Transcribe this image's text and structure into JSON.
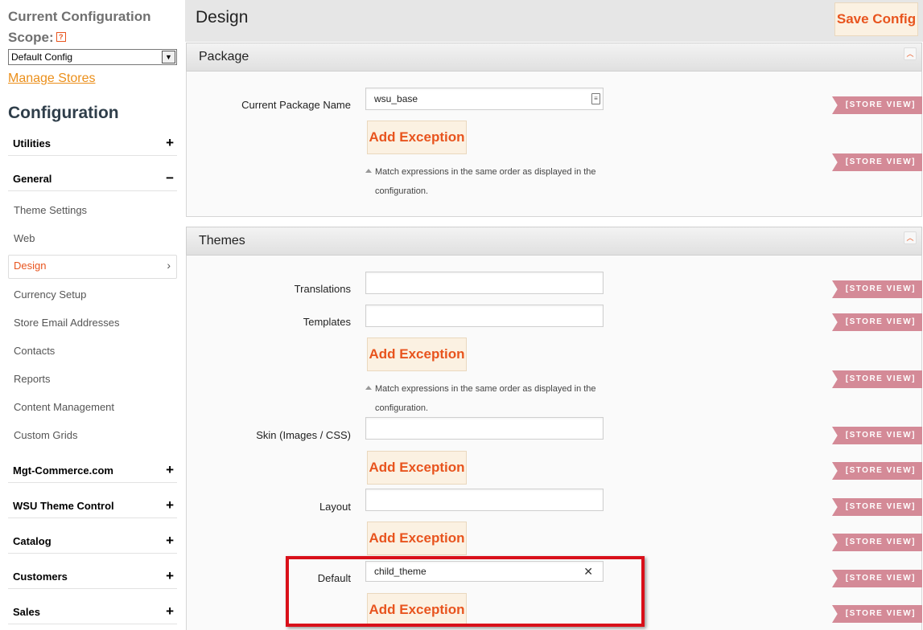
{
  "sidebar": {
    "scope_title_line1": "Current Configuration",
    "scope_title_line2": "Scope:",
    "help_icon": "?",
    "scope_select_value": "Default Config",
    "manage_stores": "Manage Stores",
    "config_title": "Configuration",
    "sections": [
      {
        "label": "Utilities",
        "toggle": "+"
      },
      {
        "label": "General",
        "toggle": "−"
      },
      {
        "label": "Mgt-Commerce.com",
        "toggle": "+"
      },
      {
        "label": "WSU Theme Control",
        "toggle": "+"
      },
      {
        "label": "Catalog",
        "toggle": "+"
      },
      {
        "label": "Customers",
        "toggle": "+"
      },
      {
        "label": "Sales",
        "toggle": "+"
      }
    ],
    "general_items": [
      {
        "label": "Theme Settings"
      },
      {
        "label": "Web"
      },
      {
        "label": "Design",
        "active": true
      },
      {
        "label": "Currency Setup"
      },
      {
        "label": "Store Email Addresses"
      },
      {
        "label": "Contacts"
      },
      {
        "label": "Reports"
      },
      {
        "label": "Content Management"
      },
      {
        "label": "Custom Grids"
      }
    ]
  },
  "main": {
    "title": "Design",
    "save_button": "Save Config",
    "scope_tag": "[STORE VIEW]",
    "note_text": "Match expressions in the same order as displayed in the configuration.",
    "add_exception": "Add Exception",
    "package": {
      "title": "Package",
      "current_package_label": "Current Package Name",
      "current_package_value": "wsu_base"
    },
    "themes": {
      "title": "Themes",
      "translations_label": "Translations",
      "templates_label": "Templates",
      "skin_label": "Skin (Images / CSS)",
      "layout_label": "Layout",
      "default_label": "Default",
      "default_value": "child_theme",
      "clear_icon": "✕"
    }
  },
  "colors": {
    "accent": "#e8541e",
    "link": "#eb8f1a",
    "scope_tag": "#d48a97",
    "highlight_border": "#d9101a",
    "button_bg": "#fbf1e2"
  }
}
